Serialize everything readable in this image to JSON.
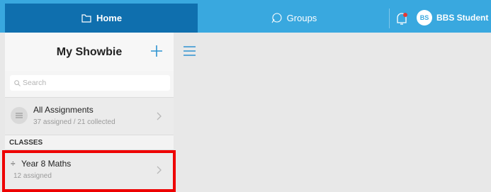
{
  "topbar": {
    "home_label": "Home",
    "groups_label": "Groups",
    "user_initials": "BS",
    "user_name": "BBS Student",
    "caret": "⌄",
    "colors": {
      "bar": "#39a8df",
      "active_tab": "#0f6fae",
      "notify_dot": "#e53935"
    }
  },
  "sidebar": {
    "title": "My Showbie",
    "search_placeholder": "Search",
    "all_assignments": {
      "label": "All Assignments",
      "sub": "37 assigned / 21 collected"
    },
    "section_label": "CLASSES",
    "classes": [
      {
        "icon": "÷",
        "label": "Year 8 Maths",
        "sub": "12 assigned"
      }
    ]
  },
  "icons": [
    "home-icon",
    "groups-icon",
    "bell-icon",
    "plus-icon",
    "search-icon",
    "list-icon",
    "chevron-right-icon",
    "menu-icon",
    "divide-icon"
  ],
  "annotation": {
    "highlight_color": "#ee0000"
  }
}
